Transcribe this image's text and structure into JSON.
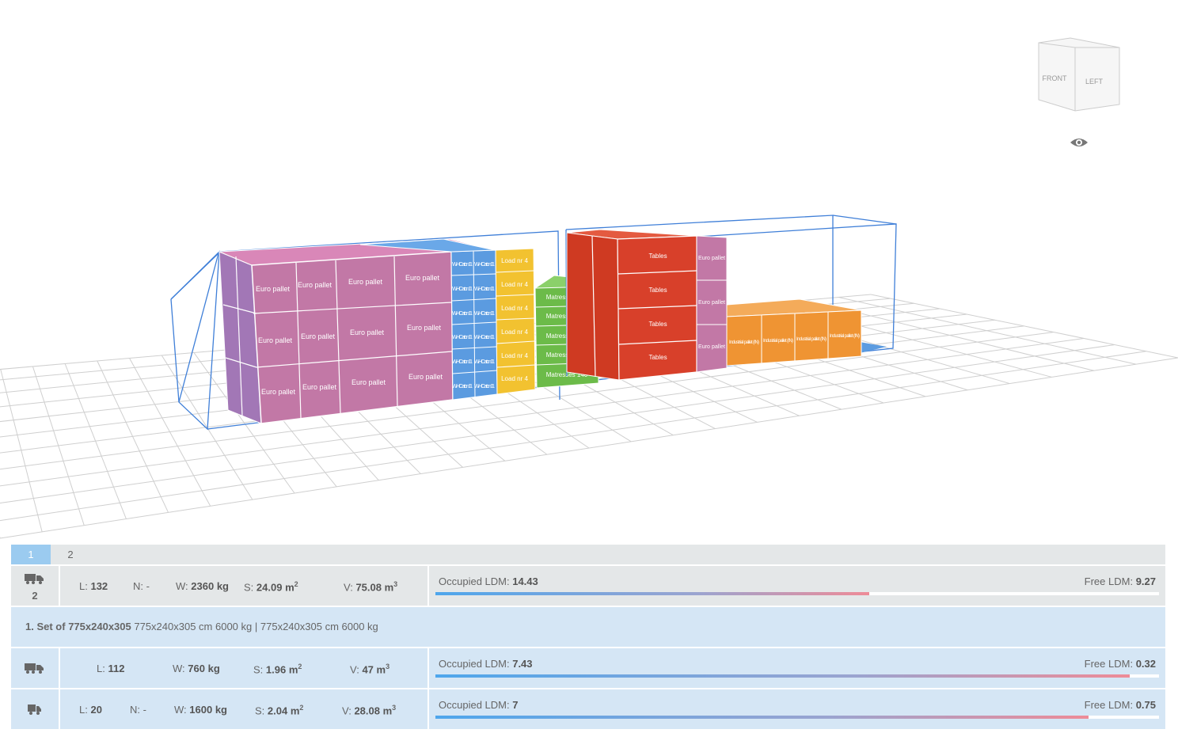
{
  "view_cube": {
    "front_label": "FRONT",
    "left_label": "LEFT"
  },
  "icons": {
    "eye": "eye-icon",
    "truck_trailer": "truck-trailer-icon",
    "truck": "truck-icon",
    "small_truck": "small-truck-icon"
  },
  "cargo_labels": {
    "euro_pallet": "Euro pallet",
    "wh_carton": "WH Carton 11",
    "load_nr4": "Load nr 4",
    "mattresses": "Matresses 140",
    "tables": "Tables",
    "industrial_pallet": "Industrial pallet (IN)"
  },
  "colors": {
    "pink": "#c278a6",
    "blue": "#5b9be0",
    "yellow": "#f2c230",
    "green": "#6cbb49",
    "red": "#d8402a",
    "orange": "#ef9433",
    "frame": "#3f7fd8",
    "grid": "#cfcfcf",
    "accent": "#9bcbf0"
  },
  "tabs": [
    {
      "label": "1",
      "active": true
    },
    {
      "label": "2",
      "active": false
    }
  ],
  "summary": {
    "count": "2",
    "L_label": "L:",
    "L": "132",
    "N_label": "N:",
    "N": "-",
    "W_label": "W:",
    "W": "2360 kg",
    "S_label": "S:",
    "S": "24.09 m",
    "V_label": "V:",
    "V": "75.08 m",
    "occupied_label": "Occupied LDM:",
    "occupied": "14.43",
    "free_label": "Free LDM:",
    "free": "9.27",
    "occupied_fraction": 0.6
  },
  "set": {
    "prefix": "1. Set of",
    "name": "775x240x305",
    "details": "775x240x305 cm 6000 kg",
    "separator": "|",
    "details2": "775x240x305 cm 6000 kg"
  },
  "vehicles": [
    {
      "L_label": "L:",
      "L": "112",
      "W_label": "W:",
      "W": "760 kg",
      "S_label": "S:",
      "S": "1.96 m",
      "V_label": "V:",
      "V": "47 m",
      "occupied_label": "Occupied LDM:",
      "occupied": "7.43",
      "free_label": "Free LDM:",
      "free": "0.32",
      "occupied_fraction": 0.959
    },
    {
      "L_label": "L:",
      "L": "20",
      "N_label": "N:",
      "N": "-",
      "W_label": "W:",
      "W": "1600 kg",
      "S_label": "S:",
      "S": "2.04 m",
      "V_label": "V:",
      "V": "28.08 m",
      "occupied_label": "Occupied LDM:",
      "occupied": "7",
      "free_label": "Free LDM:",
      "free": "0.75",
      "occupied_fraction": 0.903
    }
  ],
  "units": {
    "sup": "2",
    "sup3": "3"
  }
}
